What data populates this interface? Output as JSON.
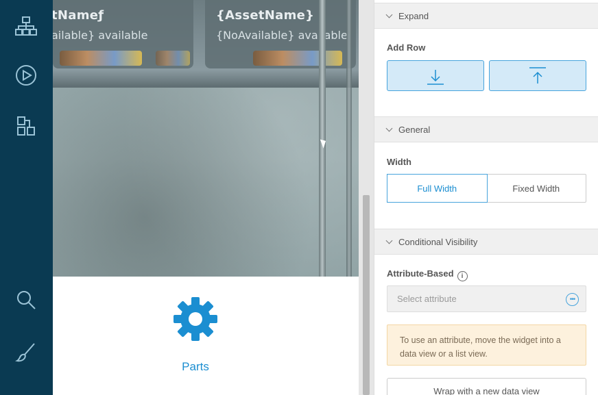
{
  "canvas": {
    "tiles": [
      {
        "name": "tNameƒ",
        "availability": "ailable} available"
      },
      {
        "name": "{AssetName}",
        "availability": "{NoAvailable} available"
      }
    ],
    "parts_card": {
      "label": "Parts",
      "icon": "gear-icon"
    }
  },
  "rail": {
    "icons": [
      "structure-icon",
      "play-icon",
      "pages-icon",
      "search-icon",
      "brush-icon"
    ]
  },
  "panel": {
    "expand_section": {
      "title": "Expand",
      "add_row_label": "Add Row",
      "buttons": [
        "add-row-below-icon",
        "add-row-above-icon"
      ]
    },
    "general_section": {
      "title": "General",
      "width_label": "Width",
      "width_options": [
        "Full Width",
        "Fixed Width"
      ],
      "width_selected": "Full Width"
    },
    "visibility_section": {
      "title": "Conditional Visibility",
      "attribute_label": "Attribute-Based",
      "attribute_placeholder": "Select attribute",
      "warning": "To use an attribute, move the widget into a data view or a list view.",
      "wrap_button": "Wrap with a new data view"
    }
  },
  "colors": {
    "rail": "#0a3a52",
    "accent": "#1b8ed1",
    "warning_bg": "#fdf1dd"
  }
}
